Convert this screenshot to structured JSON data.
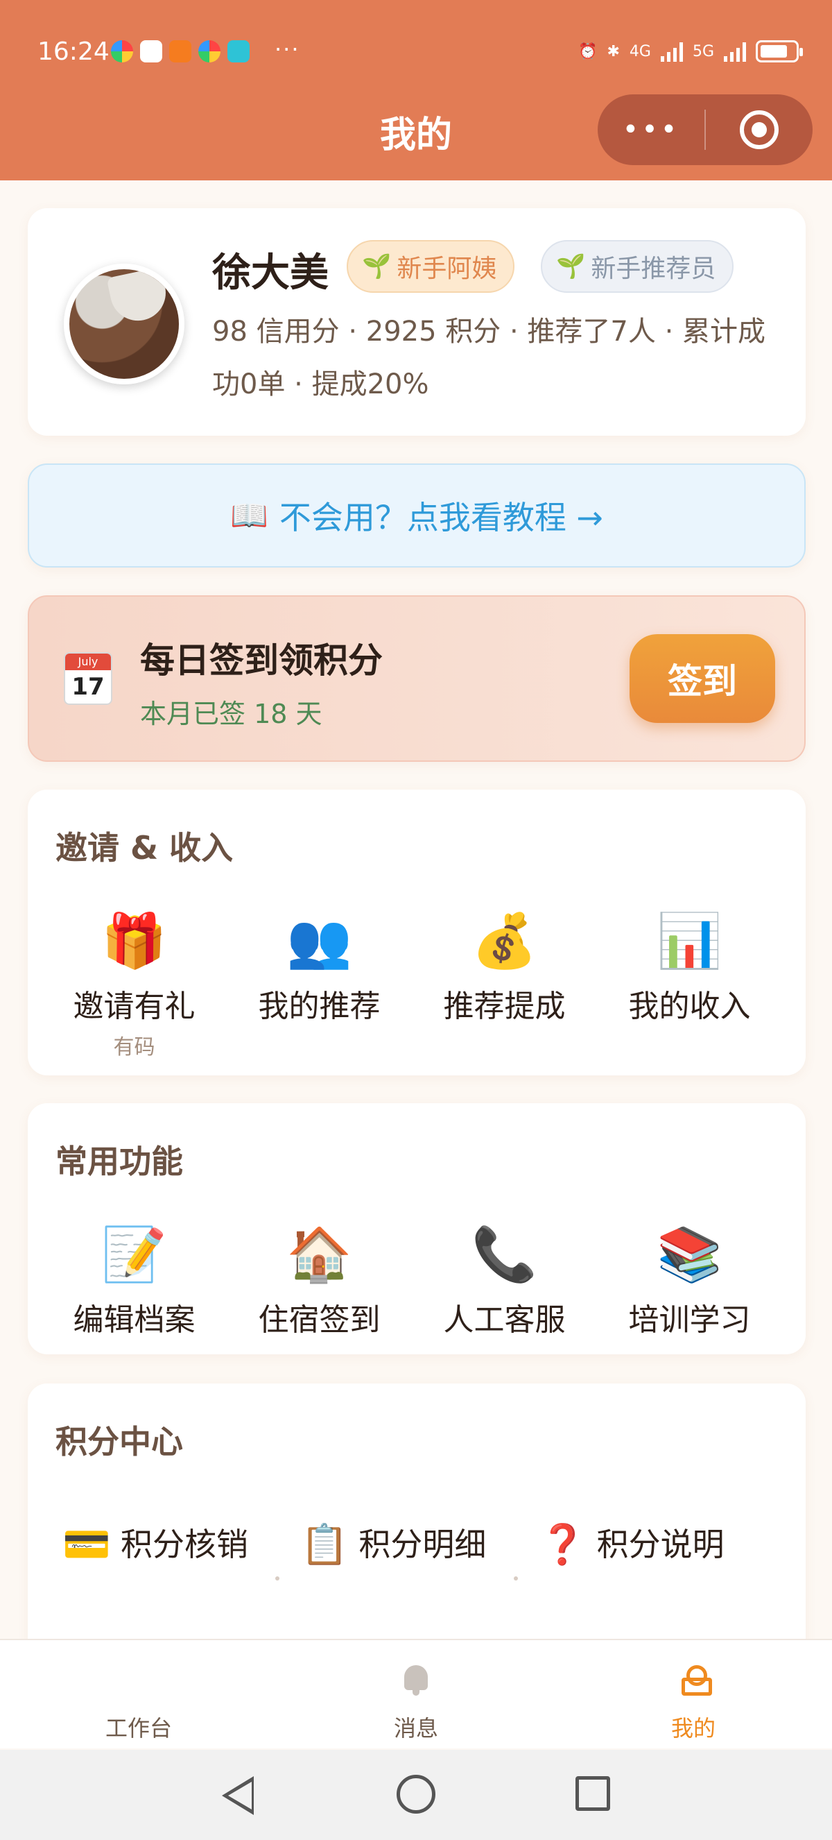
{
  "status": {
    "time": "16:24",
    "more": "···",
    "network_1": "4G",
    "network_2": "5G"
  },
  "header": {
    "title": "我的",
    "capsule_more": "•••"
  },
  "profile": {
    "name": "徐大美",
    "badges": [
      "新手阿姨",
      "新手推荐员"
    ],
    "stats_line": "98 信用分 · 2925 积分 · 推荐了7人 · 累计成功0单 · 提成20%"
  },
  "tutorial": {
    "icon": "📖",
    "text": "不会用？点我看教程 →"
  },
  "checkin": {
    "calendar_month": "July",
    "calendar_day": "17",
    "title": "每日签到领积分",
    "subtitle": "本月已签 18 天",
    "button": "签到"
  },
  "invite_section": {
    "title": "邀请 & 收入",
    "items": [
      {
        "icon": "🎁",
        "label": "邀请有礼",
        "sub": "有码"
      },
      {
        "icon": "👥",
        "label": "我的推荐",
        "sub": ""
      },
      {
        "icon": "💰",
        "label": "推荐提成",
        "sub": ""
      },
      {
        "icon": "📊",
        "label": "我的收入",
        "sub": ""
      }
    ]
  },
  "common_section": {
    "title": "常用功能",
    "items": [
      {
        "icon": "📝",
        "label": "编辑档案"
      },
      {
        "icon": "🏠",
        "label": "住宿签到"
      },
      {
        "icon": "📞",
        "label": "人工客服"
      },
      {
        "icon": "📚",
        "label": "培训学习"
      }
    ]
  },
  "points_section": {
    "title": "积分中心",
    "items": [
      {
        "icon": "💳",
        "label": "积分核销"
      },
      {
        "icon": "📋",
        "label": "积分明细"
      },
      {
        "icon": "❓",
        "label": "积分说明"
      }
    ]
  },
  "tabbar": {
    "items": [
      {
        "label": "工作台"
      },
      {
        "label": "消息"
      },
      {
        "label": "我的"
      }
    ],
    "active_color": "#ef8a1f"
  },
  "colors": {
    "header_bg": "#e27c55",
    "accent": "#ef8a1f",
    "tutorial_text": "#2f9ad9"
  }
}
